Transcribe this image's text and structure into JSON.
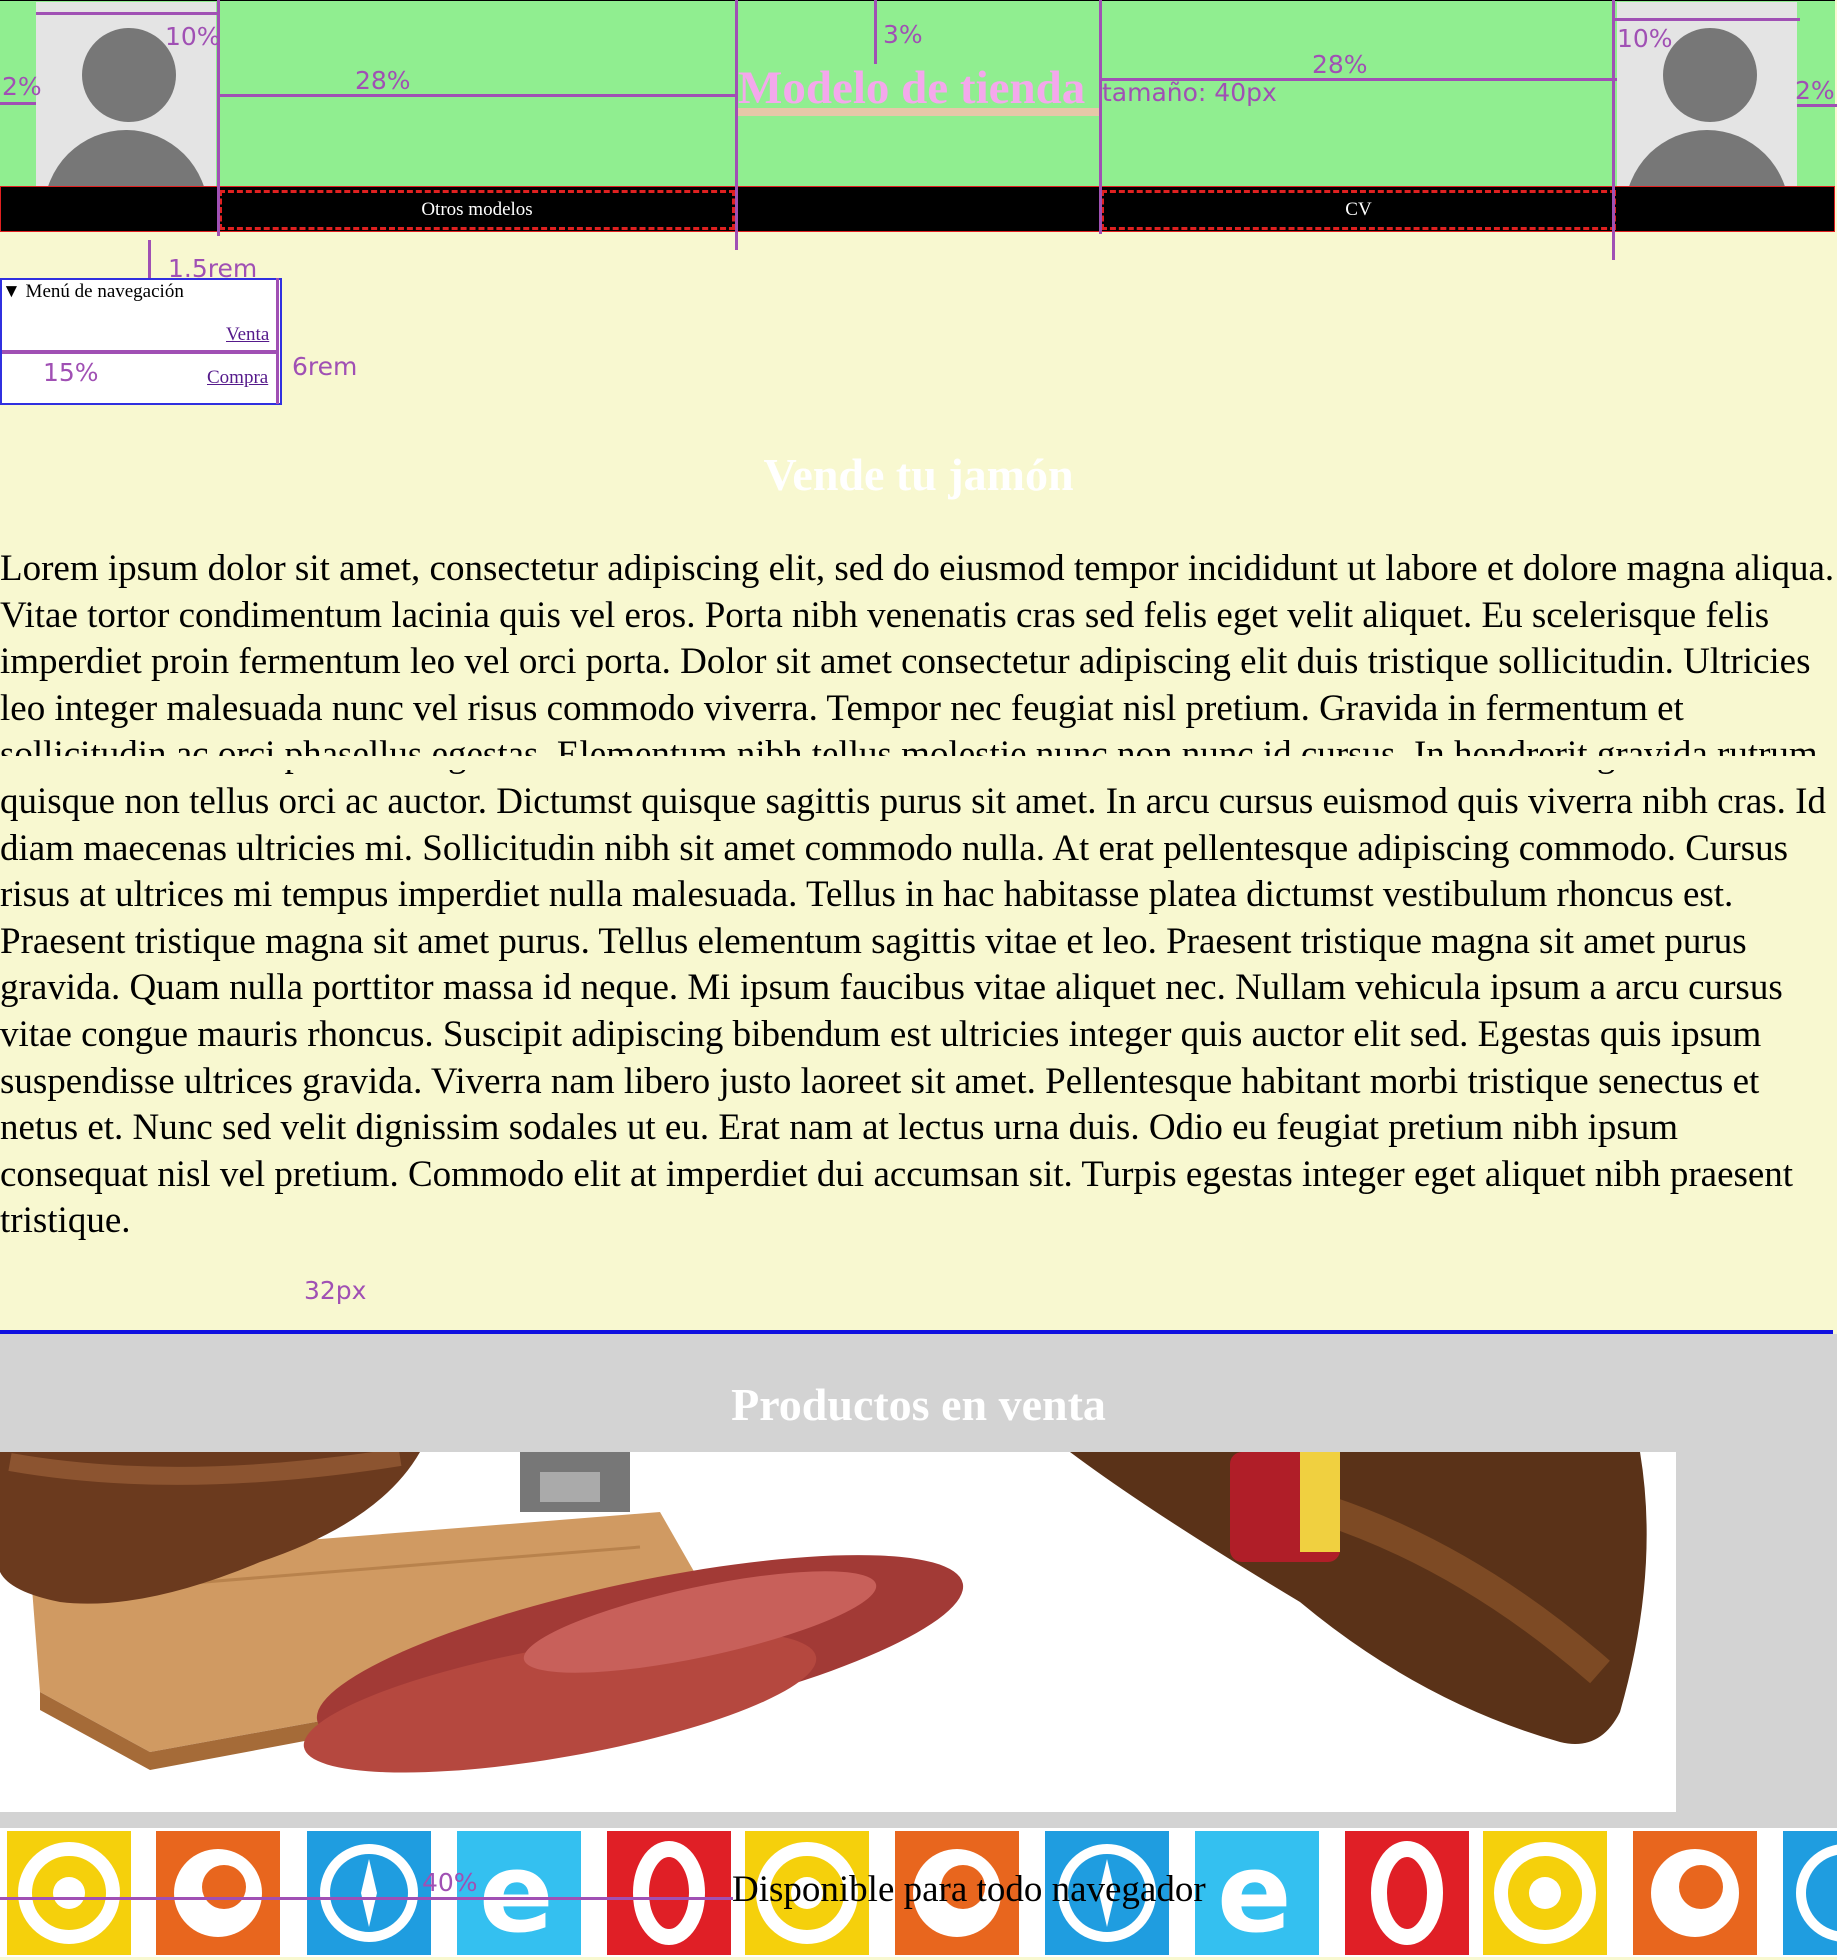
{
  "header": {
    "title": "Modelo de tienda"
  },
  "nav": {
    "links": [
      "Otros modelos",
      "CV"
    ]
  },
  "side_menu": {
    "summary": "▼ Menú de navegación",
    "links": [
      "Venta",
      "Compra"
    ]
  },
  "main": {
    "heading": "Vende tu jamón",
    "paragraph": "Lorem ipsum dolor sit amet, consectetur adipiscing elit, sed do eiusmod tempor incididunt ut labore et dolore magna aliqua. Vitae tortor condimentum lacinia quis vel eros. Porta nibh venenatis cras sed felis eget velit aliquet. Eu scelerisque felis imperdiet proin fermentum leo vel orci porta. Dolor sit amet consectetur adipiscing elit duis tristique sollicitudin. Ultricies leo integer malesuada nunc vel risus commodo viverra. Tempor nec feugiat nisl pretium. Gravida in fermentum et sollicitudin ac orci phasellus egestas. Elementum nibh tellus molestie nunc non nunc id cursus. In hendrerit gravida rutrum quisque non tellus orci ac auctor. Dictumst quisque sagittis purus sit amet. In arcu cursus euismod quis viverra nibh cras. Id diam maecenas ultricies mi. Sollicitudin nibh sit amet commodo nulla. At erat pellentesque adipiscing commodo. Cursus risus at ultrices mi tempus imperdiet nulla malesuada. Tellus in hac habitasse platea dictumst vestibulum rhoncus est. Praesent tristique magna sit amet purus. Tellus elementum sagittis vitae et leo. Praesent tristique magna sit amet purus gravida. Quam nulla porttitor massa id neque. Mi ipsum faucibus vitae aliquet nec. Nullam vehicula ipsum a arcu cursus vitae congue mauris rhoncus. Suscipit adipiscing bibendum est ultricies integer quis auctor elit sed. Egestas quis ipsum suspendisse ultrices gravida. Viverra nam libero justo laoreet sit amet. Pellentesque habitant morbi tristique senectus et netus et. Nunc sed velit dignissim sodales ut eu. Erat nam at lectus urna duis. Odio eu feugiat pretium nibh ipsum consequat nisl vel pretium. Commodo elit at imperdiet dui accumsan sit. Turpis egestas integer eget aliquet nibh praesent tristique."
  },
  "products": {
    "heading": "Productos en venta"
  },
  "browsers": {
    "caption": "Disponible para todo navegador",
    "sequence": [
      "chrome-icon",
      "firefox-icon",
      "safari-icon",
      "ie-icon",
      "opera-icon",
      "chrome-icon",
      "firefox-icon",
      "safari-icon",
      "ie-icon",
      "opera-icon",
      "chrome-icon",
      "firefox-icon",
      "safari-icon"
    ]
  },
  "annotations": {
    "left_margin": "2%",
    "avatar_left": "10%",
    "nav_left": "28%",
    "title_top": "3%",
    "title_font": "tamaño: 40px",
    "nav_right": "28%",
    "avatar_right": "10%",
    "right_margin": "2%",
    "menu_offset": "1.5rem",
    "menu_width": "15%",
    "menu_height": "6rem",
    "paragraph_margin": "32px",
    "caption_offset": "40%"
  },
  "colors": {
    "header_bg": "#90ee90",
    "page_bg": "#f8f8d0",
    "title_color": "#f4a8ec",
    "annotation": "#a050b4",
    "nav_border": "#e02020",
    "menu_border": "#3030e0"
  }
}
